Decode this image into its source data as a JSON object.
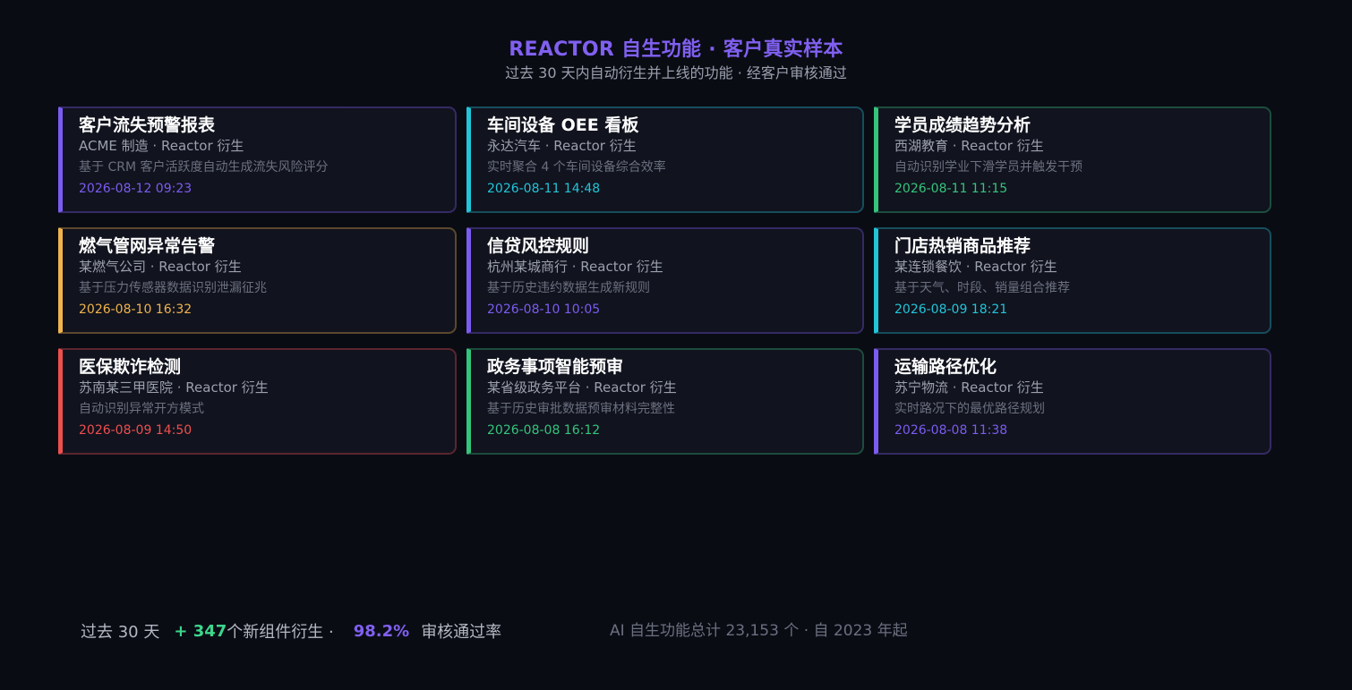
{
  "header": {
    "title": "REACTOR 自生功能 · 客户真实样本",
    "subtitle": "过去 30 天内自动衍生并上线的功能 · 经客户审核通过"
  },
  "colors": {
    "purple": "#7b5cf0",
    "cyan": "#22c5d8",
    "green": "#35c47c",
    "amber": "#f0b44c",
    "red": "#ee4f4f"
  },
  "cards": [
    {
      "title": "客户流失预警报表",
      "source": "ACME 制造 · Reactor 衍生",
      "desc": "基于 CRM 客户活跃度自动生成流失风险评分",
      "time": "2026-08-12 09:23",
      "accent": "#7b5cf0"
    },
    {
      "title": "车间设备 OEE 看板",
      "source": "永达汽车 · Reactor 衍生",
      "desc": "实时聚合 4 个车间设备综合效率",
      "time": "2026-08-11 14:48",
      "accent": "#22c5d8"
    },
    {
      "title": "学员成绩趋势分析",
      "source": "西湖教育 · Reactor 衍生",
      "desc": "自动识别学业下滑学员并触发干预",
      "time": "2026-08-11 11:15",
      "accent": "#35c47c"
    },
    {
      "title": "燃气管网异常告警",
      "source": "某燃气公司 · Reactor 衍生",
      "desc": "基于压力传感器数据识别泄漏征兆",
      "time": "2026-08-10 16:32",
      "accent": "#f0b44c"
    },
    {
      "title": "信贷风控规则",
      "source": "杭州某城商行 · Reactor 衍生",
      "desc": "基于历史违约数据生成新规则",
      "time": "2026-08-10 10:05",
      "accent": "#7b5cf0"
    },
    {
      "title": "门店热销商品推荐",
      "source": "某连锁餐饮 · Reactor 衍生",
      "desc": "基于天气、时段、销量组合推荐",
      "time": "2026-08-09 18:21",
      "accent": "#22c5d8"
    },
    {
      "title": "医保欺诈检测",
      "source": "苏南某三甲医院 · Reactor 衍生",
      "desc": "自动识别异常开方模式",
      "time": "2026-08-09 14:50",
      "accent": "#ee4f4f"
    },
    {
      "title": "政务事项智能预审",
      "source": "某省级政务平台 · Reactor 衍生",
      "desc": "基于历史审批数据预审材料完整性",
      "time": "2026-08-08 16:12",
      "accent": "#35c47c"
    },
    {
      "title": "运输路径优化",
      "source": "苏宁物流 · Reactor 衍生",
      "desc": "实时路况下的最优路径规划",
      "time": "2026-08-08 11:38",
      "accent": "#7b5cf0"
    }
  ],
  "footer": {
    "period": "过去 30 天",
    "new_count": "+ 347",
    "new_label": "个新组件衍生 ·",
    "pass_rate": "98.2%",
    "pass_label": "审核通过率",
    "total_note": "AI 自生功能总计 23,153 个 · 自 2023 年起"
  }
}
